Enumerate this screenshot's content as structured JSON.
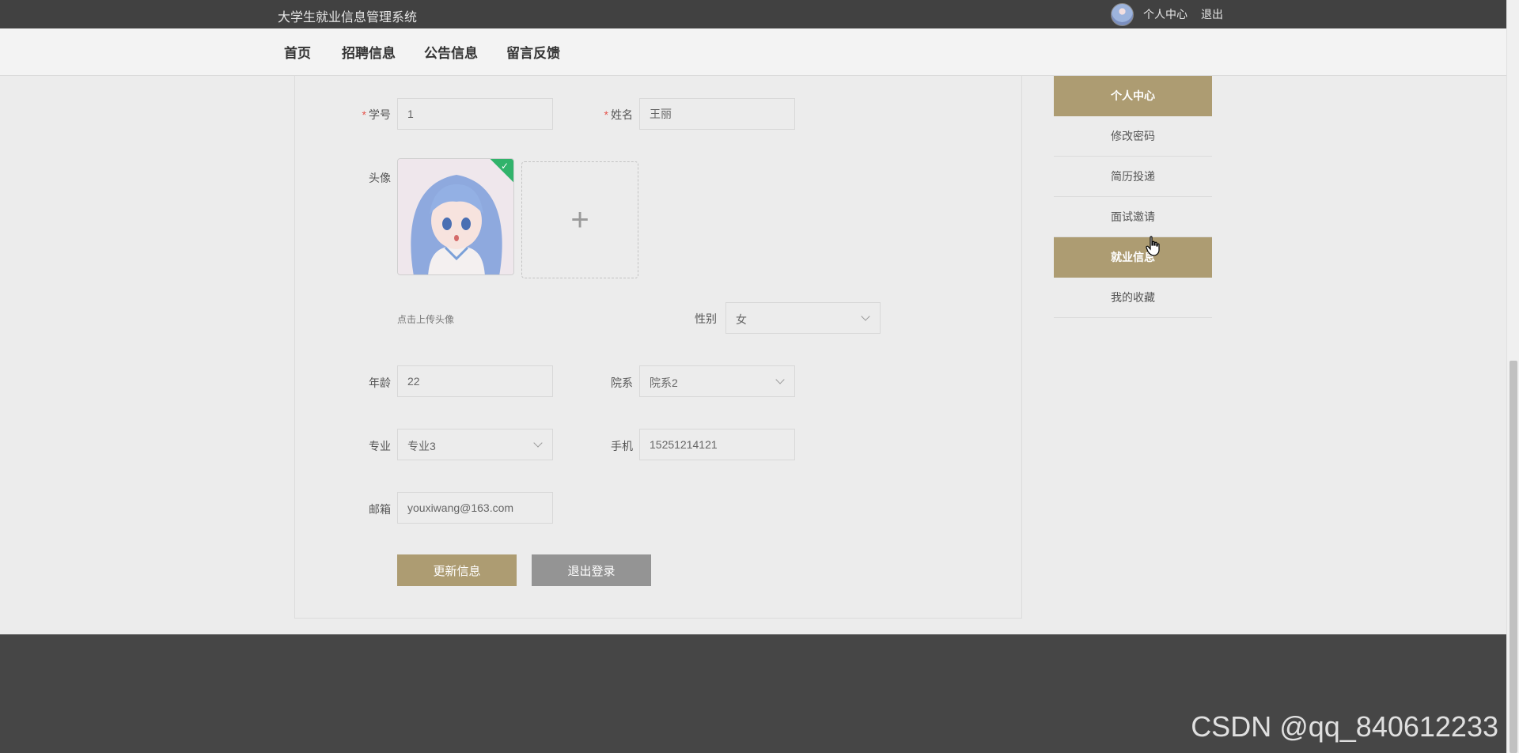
{
  "topbar": {
    "title": "大学生就业信息管理系统",
    "personal_center": "个人中心",
    "logout": "退出"
  },
  "nav": {
    "items": [
      "首页",
      "招聘信息",
      "公告信息",
      "留言反馈"
    ]
  },
  "form": {
    "student_id_label": "学号",
    "student_id_value": "1",
    "name_label": "姓名",
    "name_value": "王丽",
    "avatar_label": "头像",
    "upload_hint": "点击上传头像",
    "upload_plus": "+",
    "gender_label": "性别",
    "gender_value": "女",
    "age_label": "年龄",
    "age_value": "22",
    "department_label": "院系",
    "department_value": "院系2",
    "major_label": "专业",
    "major_value": "专业3",
    "phone_label": "手机",
    "phone_value": "15251214121",
    "email_label": "邮箱",
    "email_value": "youxiwang@163.com",
    "required_mark": "*",
    "update_button": "更新信息",
    "logout_button": "退出登录",
    "upload_checkmark": "✓"
  },
  "sidemenu": {
    "items": [
      "个人中心",
      "修改密码",
      "简历投递",
      "面试邀请",
      "就业信息",
      "我的收藏"
    ]
  },
  "watermark": "CSDN @qq_840612233",
  "colors": {
    "accent": "#ad9c72",
    "topbar": "#414141",
    "footer": "#464646",
    "secondary_button": "#949494"
  }
}
